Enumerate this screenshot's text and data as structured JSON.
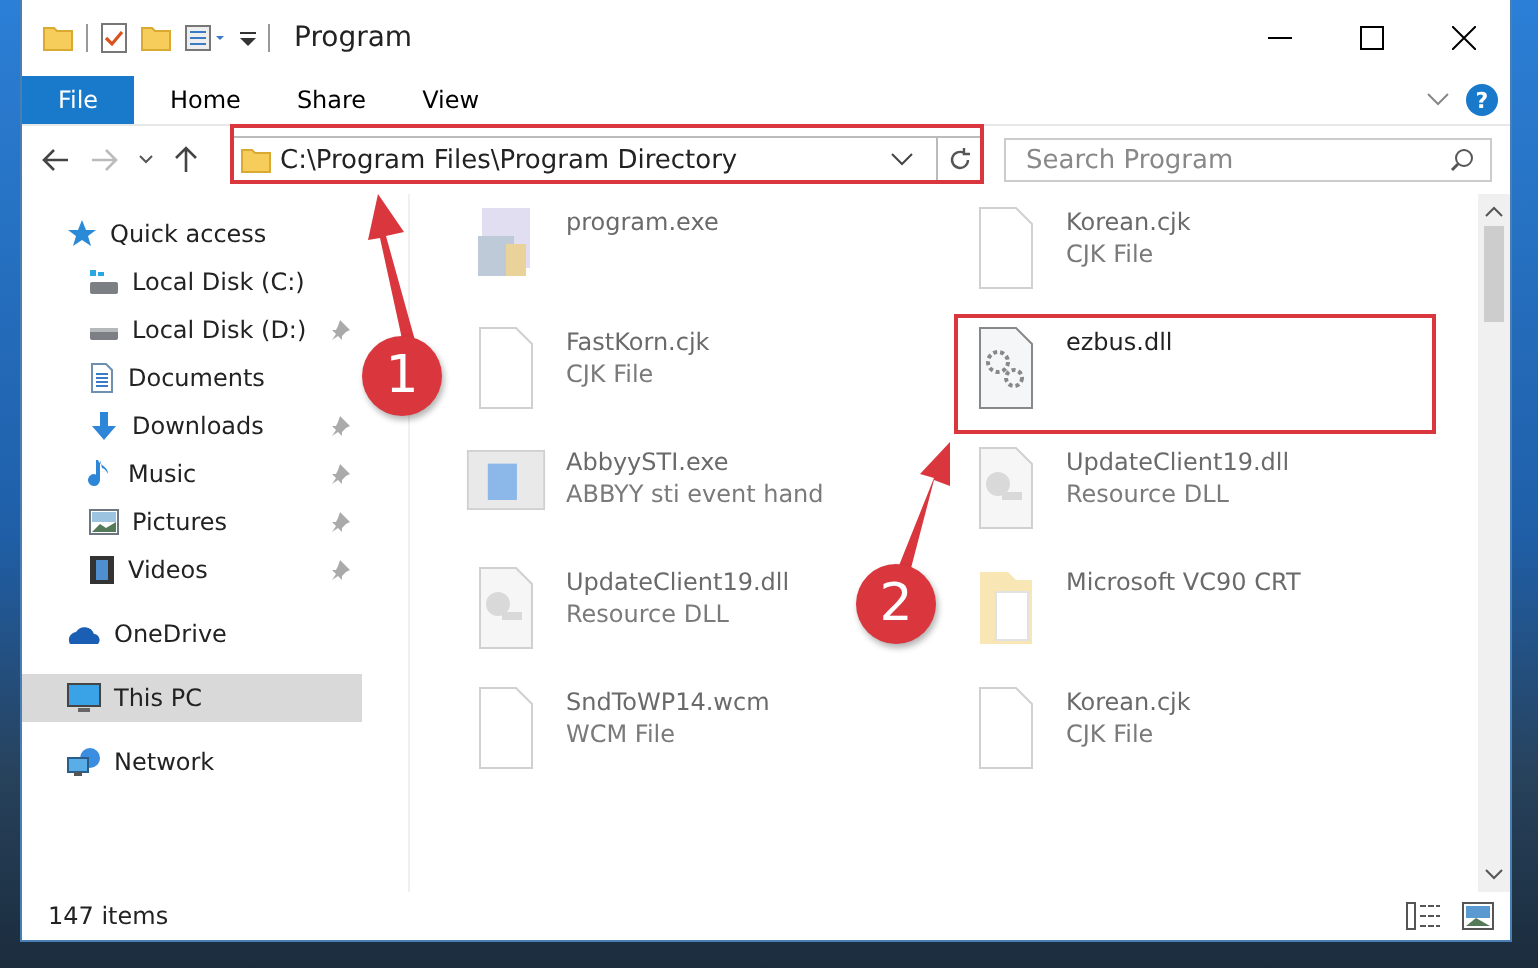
{
  "window": {
    "title": "Program"
  },
  "ribbon": {
    "tabs": [
      {
        "label": "File",
        "kind": "file"
      },
      {
        "label": "Home",
        "kind": "tab"
      },
      {
        "label": "Share",
        "kind": "tab"
      },
      {
        "label": "View",
        "kind": "tab"
      }
    ],
    "help": "?"
  },
  "address": {
    "path": "C:\\Program Files\\Program Directory"
  },
  "search": {
    "placeholder": "Search Program"
  },
  "sidebar": {
    "items": [
      {
        "label": "Quick access",
        "selected": false,
        "pinned": false,
        "children": [
          {
            "label": "Local Disk (C:)",
            "selected": false,
            "pinned": false
          },
          {
            "label": "Local Disk (D:)",
            "selected": false,
            "pinned": true
          },
          {
            "label": "Documents",
            "selected": false,
            "pinned": false
          },
          {
            "label": "Downloads",
            "selected": false,
            "pinned": true
          },
          {
            "label": "Music",
            "selected": false,
            "pinned": true
          },
          {
            "label": "Pictures",
            "selected": false,
            "pinned": true
          },
          {
            "label": "Videos",
            "selected": false,
            "pinned": true
          }
        ]
      },
      {
        "label": "OneDrive",
        "selected": false,
        "pinned": false
      },
      {
        "label": "This PC",
        "selected": true,
        "pinned": false
      },
      {
        "label": "Network",
        "selected": false,
        "pinned": false
      }
    ]
  },
  "files": [
    {
      "name": "program.exe",
      "dimmed": true,
      "highlighted": false
    },
    {
      "name": "Korean.cjk",
      "type": "CJK File",
      "dimmed": true,
      "highlighted": false
    },
    {
      "name": "FastKorn.cjk",
      "type": "CJK File",
      "dimmed": true,
      "highlighted": false
    },
    {
      "name": "ezbus.dll",
      "dimmed": false,
      "highlighted": true
    },
    {
      "name": "AbbyySTI.exe",
      "type": "ABBYY sti event hand",
      "dimmed": true,
      "highlighted": false
    },
    {
      "name": "UpdateClient19.dll",
      "type": "Resource DLL",
      "dimmed": true,
      "highlighted": false
    },
    {
      "name": "UpdateClient19.dll",
      "type": "Resource DLL",
      "dimmed": true,
      "highlighted": false
    },
    {
      "name": "Microsoft VC90 CRT",
      "dimmed": true,
      "highlighted": false
    },
    {
      "name": "SndToWP14.wcm",
      "type": "WCM File",
      "dimmed": true,
      "highlighted": false
    },
    {
      "name": "Korean.cjk",
      "type": "CJK File",
      "dimmed": true,
      "highlighted": false
    }
  ],
  "status_bar": {
    "count": "147 items"
  },
  "annotations": [
    {
      "label": "1"
    },
    {
      "label": "2"
    }
  ]
}
